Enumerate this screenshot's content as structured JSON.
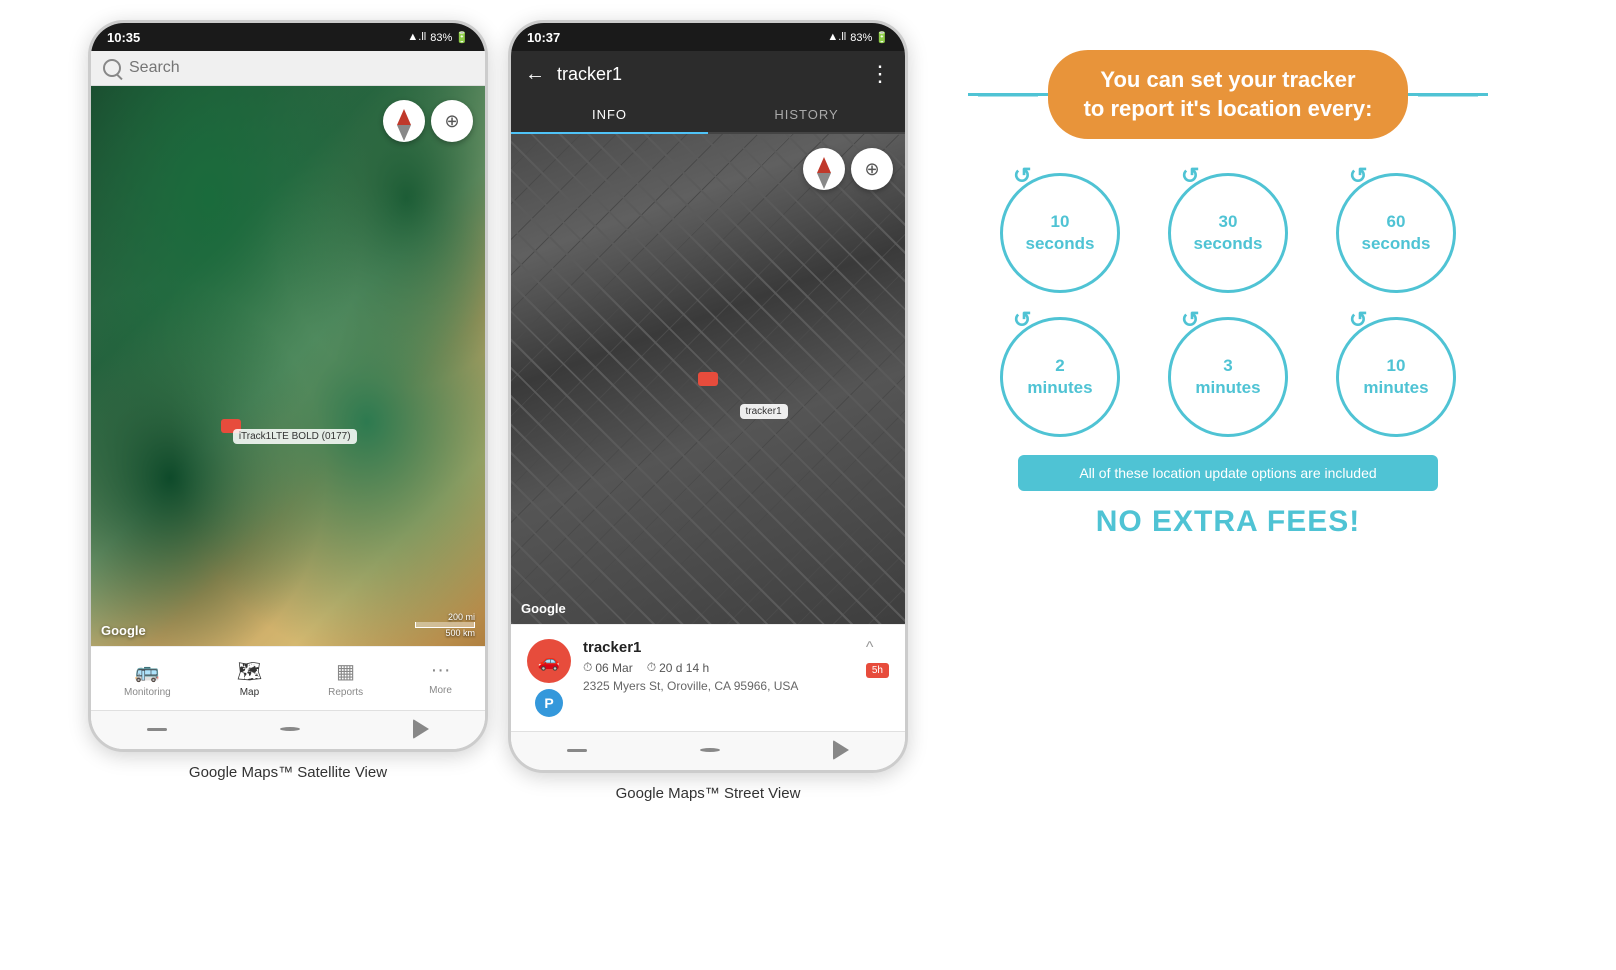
{
  "phone1": {
    "status_time": "10:35",
    "status_signal": "▲.ll 83%",
    "search_placeholder": "Search",
    "search_label": "Search",
    "google_label": "Google",
    "scale_200mi": "200 mi",
    "scale_500km": "500 km",
    "tracker_label": "iTrack1LTE BOLD (0177)",
    "nav": {
      "monitoring": "Monitoring",
      "map": "Map",
      "reports": "Reports",
      "more": "More"
    },
    "caption": "Google Maps™ Satellite View"
  },
  "phone2": {
    "status_time": "10:37",
    "status_signal": "▲.ll 83%",
    "back_label": "←",
    "title": "tracker1",
    "more_label": "⋮",
    "tab_info": "INFO",
    "tab_history": "HISTORY",
    "google_label": "Google",
    "tracker2_label": "tracker1",
    "info_panel": {
      "tracker_name": "tracker1",
      "date": "06 Mar",
      "duration": "20 d 14 h",
      "address": "2325 Myers St, Oroville, CA 95966, USA",
      "badge": "5h"
    },
    "caption": "Google Maps™ Street View"
  },
  "right_panel": {
    "headline": "You can set your tracker\nto report it's location every:",
    "circles": [
      {
        "value": "10",
        "unit": "seconds"
      },
      {
        "value": "30",
        "unit": "seconds"
      },
      {
        "value": "60",
        "unit": "seconds"
      },
      {
        "value": "2",
        "unit": "minutes"
      },
      {
        "value": "3",
        "unit": "minutes"
      },
      {
        "value": "10",
        "unit": "minutes"
      }
    ],
    "included_text": "All of these location update options are included",
    "no_fees_text": "NO EXTRA FEES!"
  }
}
